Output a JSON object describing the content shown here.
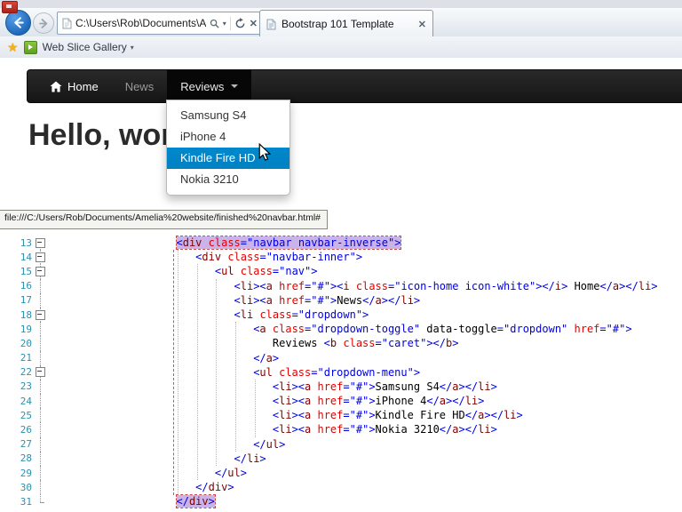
{
  "icons": {
    "star": "★",
    "caret_down": "▾",
    "close": "✕",
    "stop": "✕"
  },
  "browser": {
    "address": "C:\\Users\\Rob\\Documents\\Ar",
    "tab_title": "Bootstrap 101 Template",
    "favorites_item": "Web Slice Gallery",
    "status_tooltip": "file:///C:/Users/Rob/Documents/Amelia%20website/finished%20navbar.html#"
  },
  "page": {
    "heading": "Hello, world!",
    "nav_items": [
      {
        "label": "Home",
        "icon": "home",
        "state": "active"
      },
      {
        "label": "News",
        "state": ""
      },
      {
        "label": "Reviews",
        "state": "open",
        "caret": true
      }
    ],
    "dropdown_items": [
      {
        "label": "Samsung S4",
        "highlight": false
      },
      {
        "label": "iPhone 4",
        "highlight": false
      },
      {
        "label": "Kindle Fire HD",
        "highlight": true
      },
      {
        "label": "Nokia 3210",
        "highlight": false
      }
    ]
  },
  "colors": {
    "dropdown_highlight": "#0088cc",
    "navbar_bg": "#1b1b1b",
    "syntax_tag": "#800000",
    "syntax_attribute": "#e40000",
    "syntax_value": "#0000e0",
    "syntax_delimiter": "#0000e0",
    "line_number": "#2b91af",
    "tag_match_highlight": "#cab3e8"
  },
  "editor": {
    "first_line": 13,
    "tag_match_lines": [
      13,
      31
    ],
    "lines": [
      {
        "n": 13,
        "indent": 20,
        "fold": "box-start",
        "hl": true,
        "tokens": [
          [
            "d",
            "<"
          ],
          [
            "t",
            "div"
          ],
          [
            "x",
            " "
          ],
          [
            "a",
            "class"
          ],
          [
            "d",
            "="
          ],
          [
            "v",
            "\"navbar navbar-inverse\""
          ],
          [
            "d",
            ">"
          ]
        ]
      },
      {
        "n": 14,
        "indent": 23,
        "fold": "box",
        "tokens": [
          [
            "d",
            "<"
          ],
          [
            "t",
            "div"
          ],
          [
            "x",
            " "
          ],
          [
            "a",
            "class"
          ],
          [
            "d",
            "="
          ],
          [
            "v",
            "\"navbar-inner\""
          ],
          [
            "d",
            ">"
          ]
        ]
      },
      {
        "n": 15,
        "indent": 26,
        "fold": "box",
        "tokens": [
          [
            "d",
            "<"
          ],
          [
            "t",
            "ul"
          ],
          [
            "x",
            " "
          ],
          [
            "a",
            "class"
          ],
          [
            "d",
            "="
          ],
          [
            "v",
            "\"nav\""
          ],
          [
            "d",
            ">"
          ]
        ]
      },
      {
        "n": 16,
        "indent": 29,
        "fold": "line",
        "tokens": [
          [
            "d",
            "<"
          ],
          [
            "t",
            "li"
          ],
          [
            "d",
            "><"
          ],
          [
            "t",
            "a"
          ],
          [
            "x",
            " "
          ],
          [
            "a",
            "href"
          ],
          [
            "d",
            "="
          ],
          [
            "v",
            "\"#\""
          ],
          [
            "d",
            "><"
          ],
          [
            "t",
            "i"
          ],
          [
            "x",
            " "
          ],
          [
            "a",
            "class"
          ],
          [
            "d",
            "="
          ],
          [
            "v",
            "\"icon-home icon-white\""
          ],
          [
            "d",
            "></"
          ],
          [
            "t",
            "i"
          ],
          [
            "d",
            ">"
          ],
          [
            "x",
            " Home"
          ],
          [
            "d",
            "</"
          ],
          [
            "t",
            "a"
          ],
          [
            "d",
            "></"
          ],
          [
            "t",
            "li"
          ],
          [
            "d",
            ">"
          ]
        ]
      },
      {
        "n": 17,
        "indent": 29,
        "fold": "line",
        "tokens": [
          [
            "d",
            "<"
          ],
          [
            "t",
            "li"
          ],
          [
            "d",
            "><"
          ],
          [
            "t",
            "a"
          ],
          [
            "x",
            " "
          ],
          [
            "a",
            "href"
          ],
          [
            "d",
            "="
          ],
          [
            "v",
            "\"#\""
          ],
          [
            "d",
            ">"
          ],
          [
            "x",
            "News"
          ],
          [
            "d",
            "</"
          ],
          [
            "t",
            "a"
          ],
          [
            "d",
            "></"
          ],
          [
            "t",
            "li"
          ],
          [
            "d",
            ">"
          ]
        ]
      },
      {
        "n": 18,
        "indent": 29,
        "fold": "box",
        "tokens": [
          [
            "d",
            "<"
          ],
          [
            "t",
            "li"
          ],
          [
            "x",
            " "
          ],
          [
            "a",
            "class"
          ],
          [
            "d",
            "="
          ],
          [
            "v",
            "\"dropdown\""
          ],
          [
            "d",
            ">"
          ]
        ]
      },
      {
        "n": 19,
        "indent": 32,
        "fold": "line",
        "tokens": [
          [
            "d",
            "<"
          ],
          [
            "t",
            "a"
          ],
          [
            "x",
            " "
          ],
          [
            "a",
            "class"
          ],
          [
            "d",
            "="
          ],
          [
            "v",
            "\"dropdown-toggle\""
          ],
          [
            "x",
            " data-toggle"
          ],
          [
            "d",
            "="
          ],
          [
            "v",
            "\"dropdown\""
          ],
          [
            "x",
            " "
          ],
          [
            "a",
            "href"
          ],
          [
            "d",
            "="
          ],
          [
            "v",
            "\"#\""
          ],
          [
            "d",
            ">"
          ]
        ]
      },
      {
        "n": 20,
        "indent": 35,
        "fold": "line",
        "tokens": [
          [
            "x",
            "Reviews "
          ],
          [
            "d",
            "<"
          ],
          [
            "t",
            "b"
          ],
          [
            "x",
            " "
          ],
          [
            "a",
            "class"
          ],
          [
            "d",
            "="
          ],
          [
            "v",
            "\"caret\""
          ],
          [
            "d",
            "></"
          ],
          [
            "t",
            "b"
          ],
          [
            "d",
            ">"
          ]
        ]
      },
      {
        "n": 21,
        "indent": 32,
        "fold": "line",
        "tokens": [
          [
            "d",
            "</"
          ],
          [
            "t",
            "a"
          ],
          [
            "d",
            ">"
          ]
        ]
      },
      {
        "n": 22,
        "indent": 32,
        "fold": "box",
        "tokens": [
          [
            "d",
            "<"
          ],
          [
            "t",
            "ul"
          ],
          [
            "x",
            " "
          ],
          [
            "a",
            "class"
          ],
          [
            "d",
            "="
          ],
          [
            "v",
            "\"dropdown-menu\""
          ],
          [
            "d",
            ">"
          ]
        ]
      },
      {
        "n": 23,
        "indent": 35,
        "fold": "line",
        "tokens": [
          [
            "d",
            "<"
          ],
          [
            "t",
            "li"
          ],
          [
            "d",
            "><"
          ],
          [
            "t",
            "a"
          ],
          [
            "x",
            " "
          ],
          [
            "a",
            "href"
          ],
          [
            "d",
            "="
          ],
          [
            "v",
            "\"#\""
          ],
          [
            "d",
            ">"
          ],
          [
            "x",
            "Samsung S4"
          ],
          [
            "d",
            "</"
          ],
          [
            "t",
            "a"
          ],
          [
            "d",
            "></"
          ],
          [
            "t",
            "li"
          ],
          [
            "d",
            ">"
          ]
        ]
      },
      {
        "n": 24,
        "indent": 35,
        "fold": "line",
        "tokens": [
          [
            "d",
            "<"
          ],
          [
            "t",
            "li"
          ],
          [
            "d",
            "><"
          ],
          [
            "t",
            "a"
          ],
          [
            "x",
            " "
          ],
          [
            "a",
            "href"
          ],
          [
            "d",
            "="
          ],
          [
            "v",
            "\"#\""
          ],
          [
            "d",
            ">"
          ],
          [
            "x",
            "iPhone 4"
          ],
          [
            "d",
            "</"
          ],
          [
            "t",
            "a"
          ],
          [
            "d",
            "></"
          ],
          [
            "t",
            "li"
          ],
          [
            "d",
            ">"
          ]
        ]
      },
      {
        "n": 25,
        "indent": 35,
        "fold": "line",
        "tokens": [
          [
            "d",
            "<"
          ],
          [
            "t",
            "li"
          ],
          [
            "d",
            "><"
          ],
          [
            "t",
            "a"
          ],
          [
            "x",
            " "
          ],
          [
            "a",
            "href"
          ],
          [
            "d",
            "="
          ],
          [
            "v",
            "\"#\""
          ],
          [
            "d",
            ">"
          ],
          [
            "x",
            "Kindle Fire HD"
          ],
          [
            "d",
            "</"
          ],
          [
            "t",
            "a"
          ],
          [
            "d",
            "></"
          ],
          [
            "t",
            "li"
          ],
          [
            "d",
            ">"
          ]
        ]
      },
      {
        "n": 26,
        "indent": 35,
        "fold": "line",
        "tokens": [
          [
            "d",
            "<"
          ],
          [
            "t",
            "li"
          ],
          [
            "d",
            "><"
          ],
          [
            "t",
            "a"
          ],
          [
            "x",
            " "
          ],
          [
            "a",
            "href"
          ],
          [
            "d",
            "="
          ],
          [
            "v",
            "\"#\""
          ],
          [
            "d",
            ">"
          ],
          [
            "x",
            "Nokia 3210"
          ],
          [
            "d",
            "</"
          ],
          [
            "t",
            "a"
          ],
          [
            "d",
            "></"
          ],
          [
            "t",
            "li"
          ],
          [
            "d",
            ">"
          ]
        ]
      },
      {
        "n": 27,
        "indent": 32,
        "fold": "line",
        "tokens": [
          [
            "d",
            "</"
          ],
          [
            "t",
            "ul"
          ],
          [
            "d",
            ">"
          ]
        ]
      },
      {
        "n": 28,
        "indent": 29,
        "fold": "line",
        "tokens": [
          [
            "d",
            "</"
          ],
          [
            "t",
            "li"
          ],
          [
            "d",
            ">"
          ]
        ]
      },
      {
        "n": 29,
        "indent": 26,
        "fold": "line",
        "tokens": [
          [
            "d",
            "</"
          ],
          [
            "t",
            "ul"
          ],
          [
            "d",
            ">"
          ]
        ]
      },
      {
        "n": 30,
        "indent": 23,
        "fold": "line",
        "tokens": [
          [
            "d",
            "</"
          ],
          [
            "t",
            "div"
          ],
          [
            "d",
            ">"
          ]
        ]
      },
      {
        "n": 31,
        "indent": 20,
        "fold": "end",
        "hl": true,
        "tokens": [
          [
            "d",
            "</"
          ],
          [
            "t",
            "div"
          ],
          [
            "d",
            ">"
          ]
        ]
      }
    ],
    "guides": [
      {
        "col": 20,
        "from": 14,
        "to": 30
      },
      {
        "col": 23,
        "from": 15,
        "to": 29
      },
      {
        "col": 26,
        "from": 16,
        "to": 28
      },
      {
        "col": 29,
        "from": 19,
        "to": 27
      },
      {
        "col": 32,
        "from": 23,
        "to": 26
      }
    ]
  }
}
